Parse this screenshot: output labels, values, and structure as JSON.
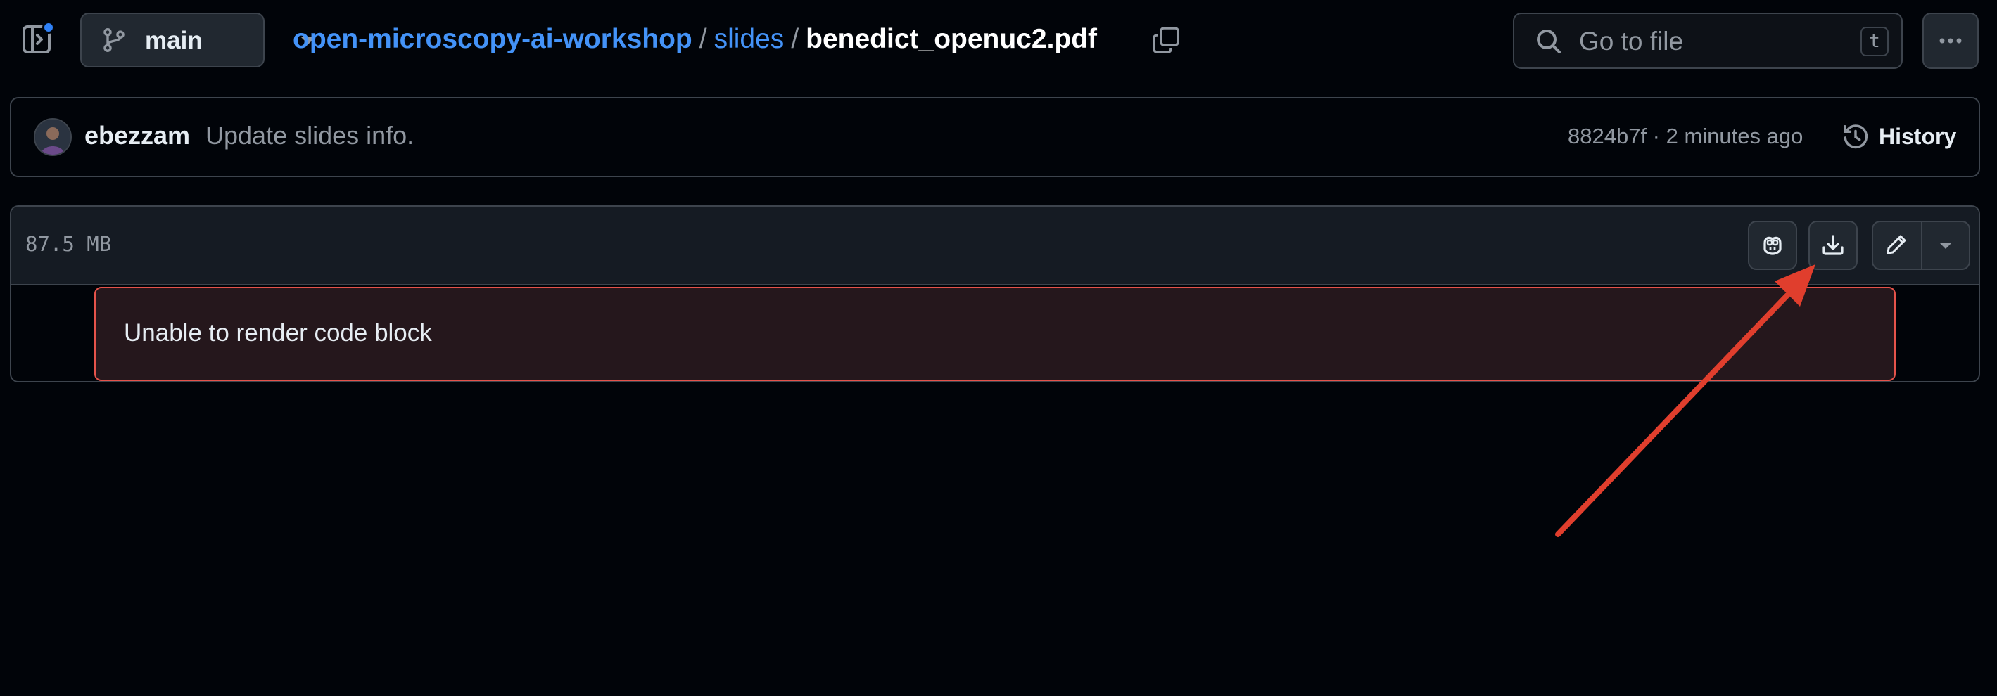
{
  "topbar": {
    "branch": "main",
    "breadcrumb": {
      "repo": "open-microscopy-ai-workshop",
      "folder": "slides",
      "file": "benedict_openuc2.pdf",
      "separator": "/"
    },
    "search": {
      "placeholder": "Go to file",
      "shortcut": "t"
    }
  },
  "commit": {
    "author": "ebezzam",
    "message": "Update slides info.",
    "meta": "8824b7f · 2 minutes ago",
    "history_label": "History"
  },
  "file": {
    "size": "87.5 MB",
    "error_message": "Unable to render code block"
  },
  "colors": {
    "background": "#010409",
    "link": "#4493f8",
    "border": "#3d444d",
    "error_border": "#e5534b",
    "annotation_arrow": "#e03e2d",
    "notification_dot": "#2f81f7"
  },
  "icons": [
    "sidebar-toggle-icon",
    "git-branch-icon",
    "copy-icon",
    "search-icon",
    "kebab-horizontal-icon",
    "history-icon",
    "copilot-icon",
    "download-icon",
    "pencil-icon",
    "triangle-down-icon"
  ]
}
